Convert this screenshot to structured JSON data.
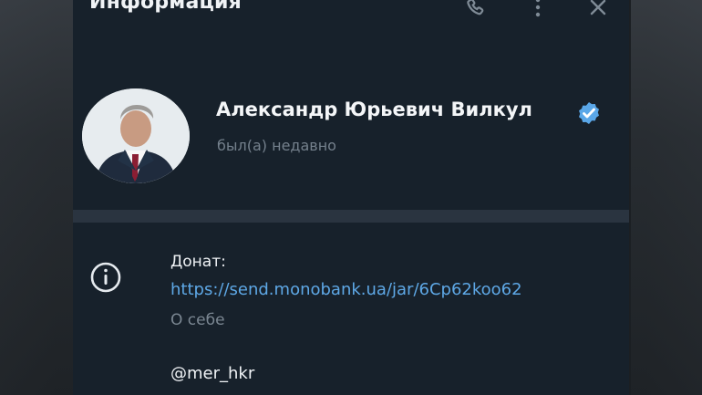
{
  "header": {
    "title": "Информация",
    "icons": [
      "phone-icon",
      "more-vertical-icon",
      "close-icon"
    ]
  },
  "profile": {
    "name": "Александр Юрьевич Вилкул",
    "status": "был(а) недавно",
    "verified": true
  },
  "info": {
    "donate_label": "Донат:",
    "donate_link": "https://send.monobank.ua/jar/6Cp62koo62",
    "about_label": "О себе",
    "username": "@mer_hkr"
  },
  "colors": {
    "panel_bg": "#17212b",
    "link": "#5ea8e6",
    "verified": "#5aa7e8",
    "muted": "#74808c"
  }
}
